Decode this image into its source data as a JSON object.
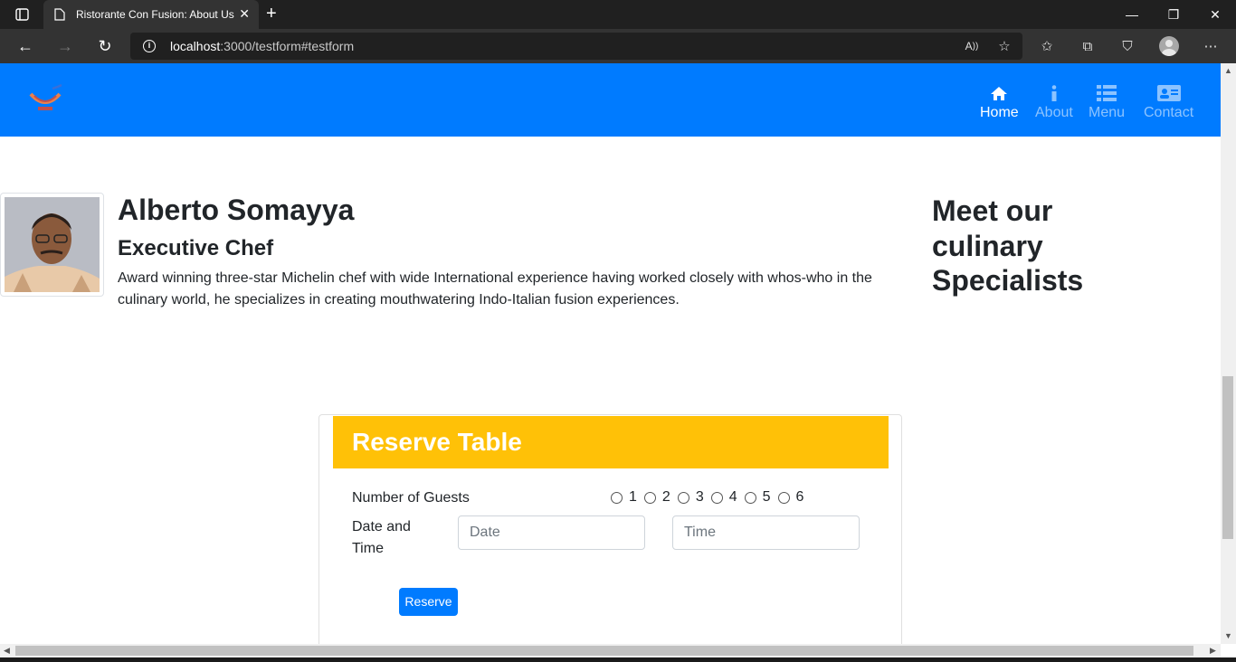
{
  "browser": {
    "tab_title": "Ristorante Con Fusion: About Us",
    "url_host": "localhost",
    "url_rest": ":3000/testform#testform"
  },
  "navbar": {
    "items": [
      {
        "label": "Home",
        "icon": "home-icon",
        "active": true
      },
      {
        "label": "About",
        "icon": "info-icon",
        "active": false
      },
      {
        "label": "Menu",
        "icon": "list-icon",
        "active": false
      },
      {
        "label": "Contact",
        "icon": "address-card-icon",
        "active": false
      }
    ],
    "color": "#007bff"
  },
  "chef": {
    "name": "Alberto Somayya",
    "title": "Executive Chef",
    "description": "Award winning three-star Michelin chef with wide International experience having worked closely with whos-who in the culinary world, he specializes in creating mouthwatering Indo-Italian fusion experiences."
  },
  "aside": {
    "heading": "Meet our culinary Specialists"
  },
  "reserve": {
    "header": "Reserve Table",
    "header_color": "#ffc107",
    "guests_label": "Number of Guests",
    "guest_options": [
      "1",
      "2",
      "3",
      "4",
      "5",
      "6"
    ],
    "datetime_label": "Date and Time",
    "date_placeholder": "Date",
    "time_placeholder": "Time",
    "button_label": "Reserve"
  }
}
